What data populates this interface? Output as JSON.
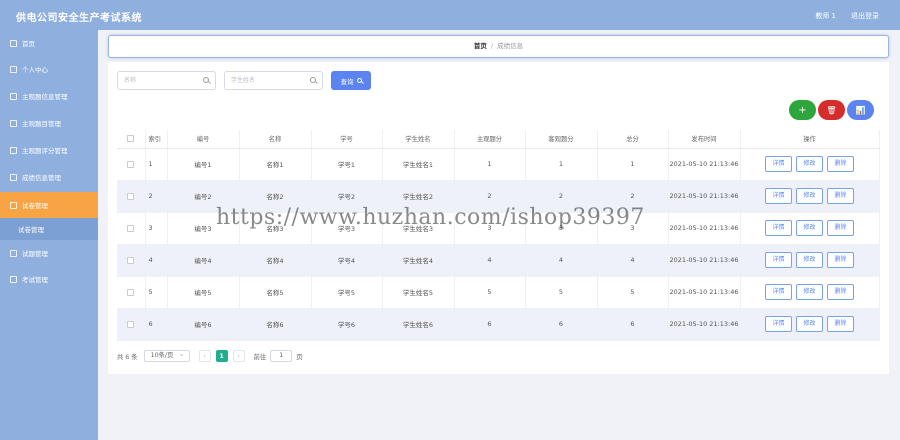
{
  "header": {
    "title": "供电公司安全生产考试系统",
    "user": "教师 1",
    "logout": "退出登录"
  },
  "sidebar": {
    "items": [
      {
        "label": "首页",
        "icon": "home-icon"
      },
      {
        "label": "个人中心",
        "icon": "user-icon"
      },
      {
        "label": "主观题信息管理",
        "icon": "info-icon"
      },
      {
        "label": "主观题目管理",
        "icon": "list-icon"
      },
      {
        "label": "主观题评分管理",
        "icon": "list-icon"
      },
      {
        "label": "成绩信息管理",
        "icon": "grade-icon"
      },
      {
        "label": "试卷管理",
        "icon": "paper-icon"
      },
      {
        "label": "试题管理",
        "icon": "question-icon"
      },
      {
        "label": "考试管理",
        "icon": "exam-icon"
      }
    ],
    "sub_item": "试卷管理"
  },
  "breadcrumb": {
    "home": "首页",
    "separator": "/",
    "current": "成绩信息"
  },
  "search": {
    "name_placeholder": "名称",
    "student_placeholder": "学生姓名",
    "button": "查询"
  },
  "toolbar": {
    "add": "+",
    "delete": "🗑",
    "chart": "📊"
  },
  "table": {
    "columns": [
      "索引",
      "编号",
      "名称",
      "学号",
      "学生姓名",
      "主观题分",
      "客观题分",
      "总分",
      "发布时间",
      "操作"
    ],
    "rows": [
      {
        "index": "1",
        "code": "编号1",
        "name": "名称1",
        "student_no": "学号1",
        "student_name": "学生姓名1",
        "subjective": "1",
        "objective": "1",
        "total": "1",
        "time": "2021-05-10 21:13:46"
      },
      {
        "index": "2",
        "code": "编号2",
        "name": "名称2",
        "student_no": "学号2",
        "student_name": "学生姓名2",
        "subjective": "2",
        "objective": "2",
        "total": "2",
        "time": "2021-05-10 21:13:46"
      },
      {
        "index": "3",
        "code": "编号3",
        "name": "名称3",
        "student_no": "学号3",
        "student_name": "学生姓名3",
        "subjective": "3",
        "objective": "3",
        "total": "3",
        "time": "2021-05-10 21:13:46"
      },
      {
        "index": "4",
        "code": "编号4",
        "name": "名称4",
        "student_no": "学号4",
        "student_name": "学生姓名4",
        "subjective": "4",
        "objective": "4",
        "total": "4",
        "time": "2021-05-10 21:13:46"
      },
      {
        "index": "5",
        "code": "编号5",
        "name": "名称5",
        "student_no": "学号5",
        "student_name": "学生姓名5",
        "subjective": "5",
        "objective": "5",
        "total": "5",
        "time": "2021-05-10 21:13:46"
      },
      {
        "index": "6",
        "code": "编号6",
        "name": "名称6",
        "student_no": "学号6",
        "student_name": "学生姓名6",
        "subjective": "6",
        "objective": "6",
        "total": "6",
        "time": "2021-05-10 21:13:46"
      }
    ],
    "actions": [
      "详情",
      "修改",
      "删除"
    ]
  },
  "pagination": {
    "total_text": "共 6 条",
    "page_size": "10条/页",
    "prev": "‹",
    "current_page": "1",
    "next": "›",
    "goto_label": "前往",
    "goto_value": "1",
    "page_suffix": "页"
  },
  "watermark": "https://www.huzhan.com/ishop39397",
  "colors": {
    "sidebar": "#8fb0df",
    "active_menu": "#f7a444",
    "primary": "#5b84f0",
    "add": "#2da63b",
    "delete": "#d52c2c",
    "pager_active": "#23ad8f"
  }
}
